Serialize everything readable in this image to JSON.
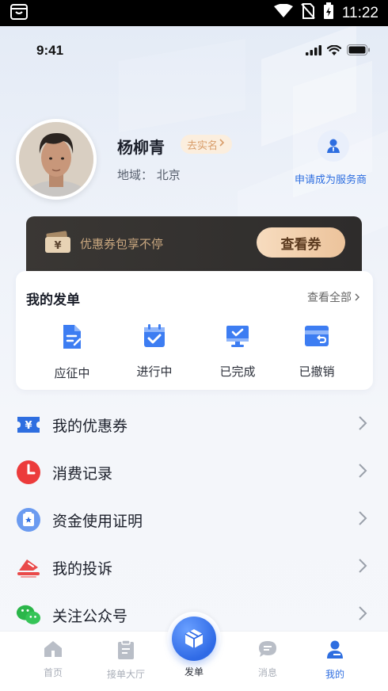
{
  "system_bar": {
    "time": "11:22"
  },
  "ios_status": {
    "time": "9:41"
  },
  "profile": {
    "name": "杨柳青",
    "verify_label": "去实名",
    "region": "地域：  北京",
    "apply_label": "申请成为服务商"
  },
  "coupon_banner": {
    "text": "优惠券包享不停",
    "button": "查看券"
  },
  "orders": {
    "title": "我的发单",
    "view_all": "查看全部",
    "items": [
      {
        "label": "应征中",
        "icon": "document-edit-icon"
      },
      {
        "label": "进行中",
        "icon": "calendar-check-icon"
      },
      {
        "label": "已完成",
        "icon": "monitor-check-icon"
      },
      {
        "label": "已撤销",
        "icon": "card-undo-icon"
      }
    ]
  },
  "menu": [
    {
      "label": "我的优惠券",
      "icon": "coupon-icon"
    },
    {
      "label": "消费记录",
      "icon": "clock-icon"
    },
    {
      "label": "资金使用证明",
      "icon": "certificate-icon"
    },
    {
      "label": "我的投诉",
      "icon": "complaint-icon"
    },
    {
      "label": "关注公众号",
      "icon": "wechat-icon"
    }
  ],
  "tabbar": {
    "tabs": [
      {
        "label": "首页",
        "icon": "home-icon"
      },
      {
        "label": "接单大厅",
        "icon": "clipboard-icon"
      },
      {
        "label": "发单",
        "icon": "package-icon"
      },
      {
        "label": "消息",
        "icon": "message-icon"
      },
      {
        "label": "我的",
        "icon": "user-icon"
      }
    ],
    "active": "我的"
  },
  "colors": {
    "accent": "#2e6ee0",
    "coupon_gold": "#c9a77f",
    "coupon_bg": "#322f2d"
  }
}
